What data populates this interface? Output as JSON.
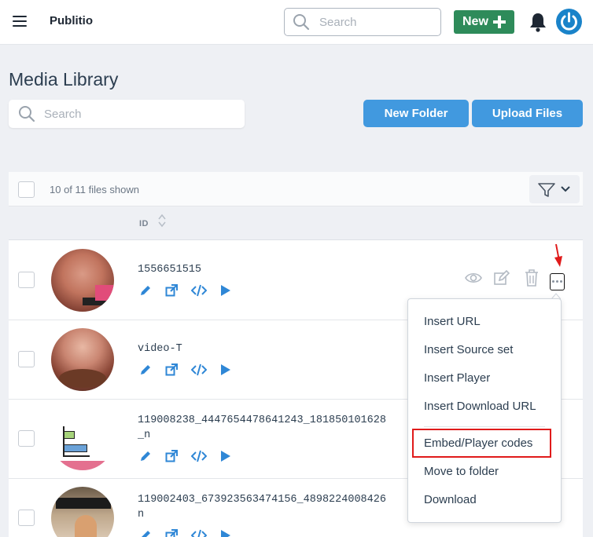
{
  "app": {
    "name": "Publitio"
  },
  "topbar": {
    "search_placeholder": "Search",
    "new_label": "New"
  },
  "page": {
    "title": "Media Library",
    "search_placeholder": "Search"
  },
  "buttons": {
    "new_folder": "New Folder",
    "upload_files": "Upload Files"
  },
  "table": {
    "shown_text": "10 of 11 files shown",
    "column_id": "ID",
    "rows": [
      {
        "id_line1": "1556651515",
        "id_line2": ""
      },
      {
        "id_line1": "video-T",
        "id_line2": ""
      },
      {
        "id_line1": "119008238_4447654478641243_181850101628",
        "id_line2": "_n"
      },
      {
        "id_line1": "119002403_673923563474156_4898224008426",
        "id_line2": "n"
      }
    ]
  },
  "dropdown": {
    "items": [
      "Insert URL",
      "Insert Source set",
      "Insert Player",
      "Insert Download URL",
      "Embed/Player codes",
      "Move to folder",
      "Download"
    ],
    "highlighted": "Embed/Player codes"
  },
  "colors": {
    "green": "#2e8b5a",
    "blue": "#4199df",
    "accent": "#1a83c9",
    "highlight": "#e01b1b"
  }
}
